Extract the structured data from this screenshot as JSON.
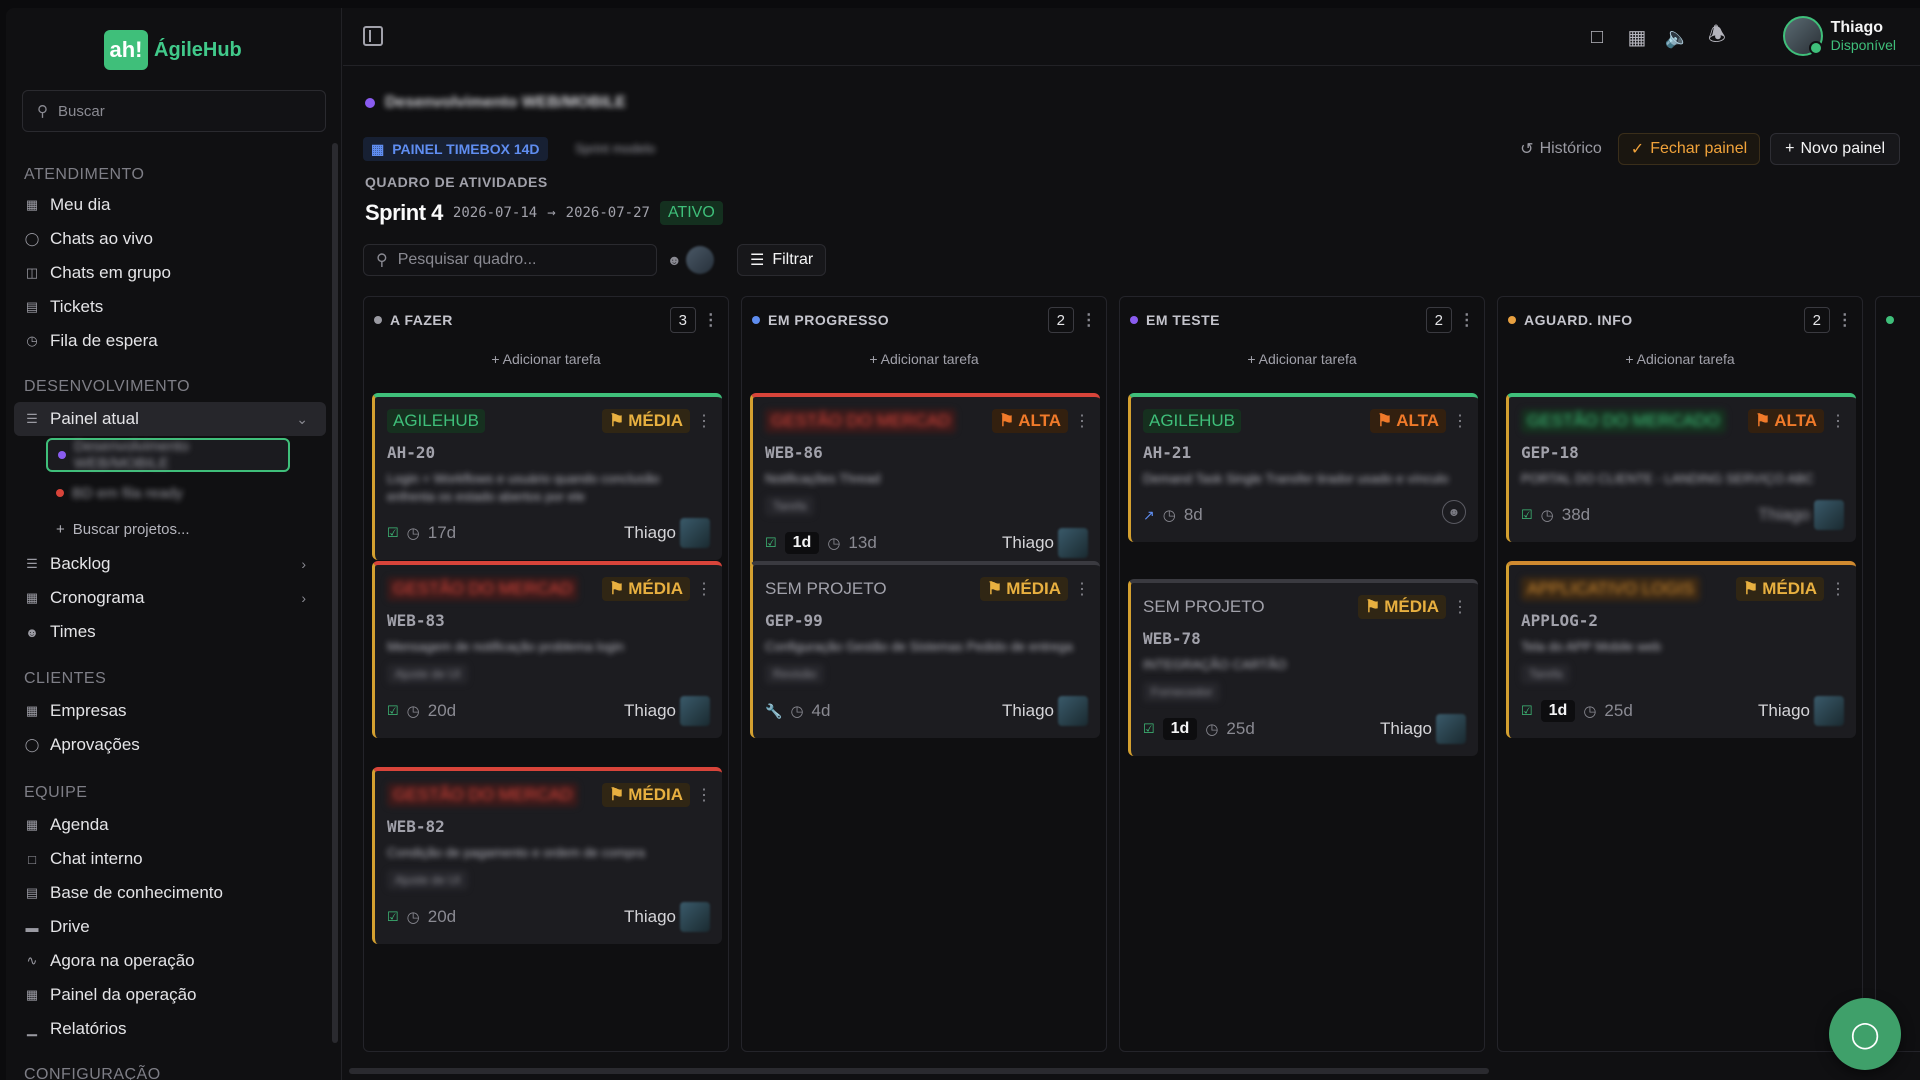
{
  "brand": {
    "name": "ÁgileHub",
    "mark": "ah!"
  },
  "sidebar": {
    "search_placeholder": "Buscar",
    "sections": {
      "atendimento": "ATENDIMENTO",
      "desenvolvimento": "DESENVOLVIMENTO",
      "clientes": "CLIENTES",
      "equipe": "EQUIPE",
      "configuracao": "CONFIGURAÇÃO"
    },
    "atendimento_items": [
      "Meu dia",
      "Chats ao vivo",
      "Chats em grupo",
      "Tickets",
      "Fila de espera"
    ],
    "dev_items": {
      "painel_atual": "Painel atual",
      "sub1": "Desenvolvimento WEB/MOBILE",
      "sub2": "BD em fila ready",
      "buscar_projetos": "Buscar projetos...",
      "backlog": "Backlog",
      "cronograma": "Cronograma",
      "times": "Times"
    },
    "clientes_items": [
      "Empresas",
      "Aprovações"
    ],
    "equipe_items": [
      "Agenda",
      "Chat interno",
      "Base de conhecimento",
      "Drive",
      "Agora na operação",
      "Painel da operação",
      "Relatórios"
    ]
  },
  "topbar": {
    "icons": [
      "chat-icon",
      "calendar-icon",
      "speaker-icon",
      "bell-icon"
    ],
    "user": {
      "name": "Thiago",
      "status": "Disponível"
    }
  },
  "header": {
    "project_name": "Desenvolvimento WEB/MOBILE",
    "panel_badge": "PAINEL TIMEBOX 14D",
    "panel_badge_sub": "Sprint modelo",
    "actions": {
      "historico": "Histórico",
      "fechar": "Fechar painel",
      "novo": "Novo painel"
    },
    "quadro_label": "QUADRO DE ATIVIDADES",
    "sprint": {
      "name": "Sprint 4",
      "start": "2026-07-14",
      "arrow": "→",
      "end": "2026-07-27",
      "status": "ATIVO"
    },
    "search_placeholder": "Pesquisar quadro...",
    "filter_label": "Filtrar"
  },
  "board": {
    "add_task": "Adicionar tarefa",
    "columns": [
      {
        "title": "A FAZER",
        "count": "3",
        "color": "#9a9aa2"
      },
      {
        "title": "EM PROGRESSO",
        "count": "2",
        "color": "#5f8df0"
      },
      {
        "title": "EM TESTE",
        "count": "2",
        "color": "#8a5cf0"
      },
      {
        "title": "AGUARD. INFO",
        "count": "2",
        "color": "#e8a040"
      }
    ],
    "cards": {
      "c1": {
        "project": "AGILEHUB",
        "priority": "MÉDIA",
        "id": "AH-20",
        "desc": "Login + Workflows e usuário quando conclusão enfrenta os estado abertos por ele",
        "time": "17d",
        "assignee": "Thiago"
      },
      "c2": {
        "project": "GESTÃO DO MERCAD",
        "priority": "MÉDIA",
        "id": "WEB-83",
        "desc": "Mensagem de notificação problema login",
        "chip": "Ajuste de UI",
        "time": "20d",
        "assignee": "Thiago"
      },
      "c3": {
        "project": "GESTÃO DO MERCAD",
        "priority": "MÉDIA",
        "id": "WEB-82",
        "desc": "Condição de pagamento e ordem de compra",
        "chip": "Ajuste de UI",
        "time": "20d",
        "assignee": "Thiago"
      },
      "c4": {
        "project": "GESTÃO DO MERCAD",
        "priority": "ALTA",
        "id": "WEB-86",
        "desc": "Notificações Thread",
        "chip": "Tarefa",
        "estimate": "1d",
        "time": "13d",
        "assignee": "Thiago"
      },
      "c5": {
        "project": "SEM PROJETO",
        "priority": "MÉDIA",
        "id": "GEP-99",
        "desc": "Configuração Gestão de Sistemas Pedido de entrega",
        "chip": "Revisão",
        "time": "4d",
        "assignee": "Thiago"
      },
      "c6": {
        "project": "AGILEHUB",
        "priority": "ALTA",
        "id": "AH-21",
        "desc": "Demand Task Single Transfer tirador usado e vínculo",
        "time": "8d"
      },
      "c7": {
        "project": "SEM PROJETO",
        "priority": "MÉDIA",
        "id": "WEB-78",
        "desc": "INTEGRAÇÃO CARTÃO",
        "chip": "Fornecedor",
        "estimate": "1d",
        "time": "25d",
        "assignee": "Thiago"
      },
      "c8": {
        "project": "GESTÃO DO MERCADO",
        "priority": "ALTA",
        "id": "GEP-18",
        "desc": "PORTAL DO CLIENTE - LANDING SERVIÇO ABC",
        "time": "38d",
        "assignee": "Thiago"
      },
      "c9": {
        "project": "APPLICATIVO LOGIS",
        "priority": "MÉDIA",
        "id": "APPLOG-2",
        "desc": "Tela do APP Mobile web",
        "chip": "Tarefa",
        "estimate": "1d",
        "time": "25d",
        "assignee": "Thiago"
      }
    }
  }
}
